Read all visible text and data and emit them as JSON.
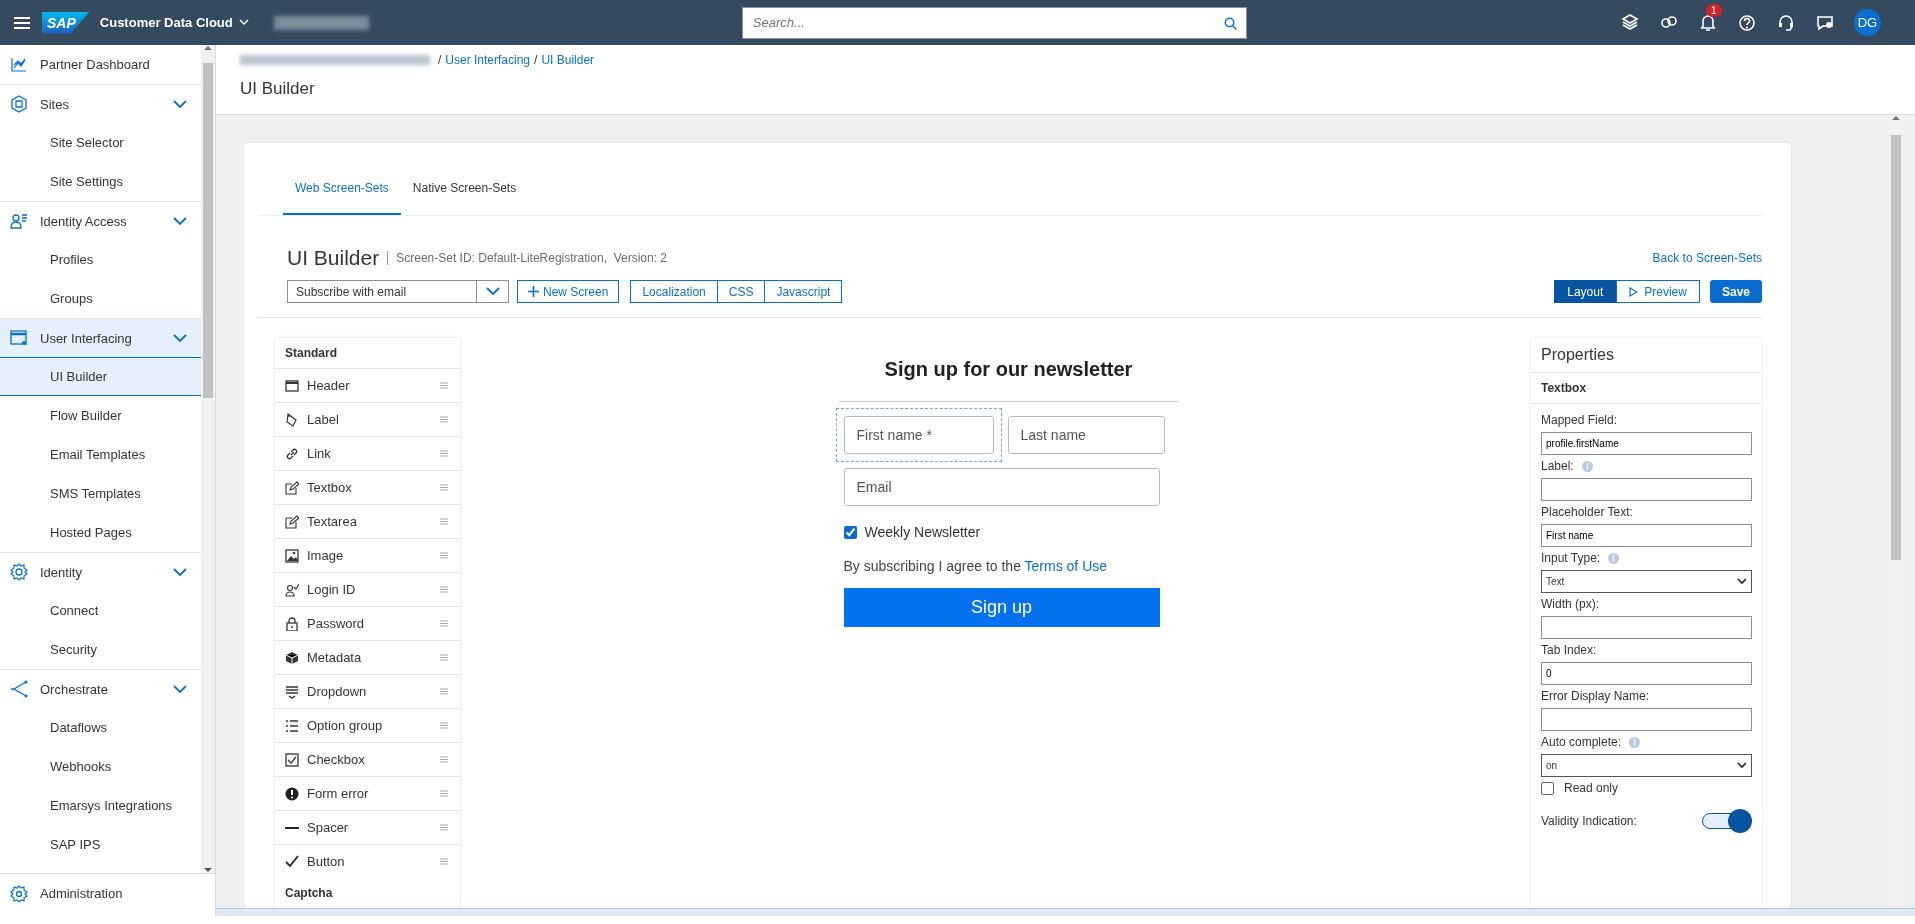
{
  "topbar": {
    "logo": "SAP",
    "product": "Customer Data Cloud",
    "search": {
      "placeholder": "Search..."
    },
    "notification_count": "1",
    "avatar": "DG"
  },
  "sidebar": {
    "items": [
      {
        "label": "Partner Dashboard",
        "selected": false
      },
      {
        "label": "Sites",
        "selected": false,
        "expanded": true,
        "children": [
          {
            "label": "Site Selector",
            "selected": false
          },
          {
            "label": "Site Settings",
            "selected": false
          }
        ]
      },
      {
        "label": "Identity Access",
        "selected": false,
        "expanded": true,
        "children": [
          {
            "label": "Profiles",
            "selected": false
          },
          {
            "label": "Groups",
            "selected": false
          }
        ]
      },
      {
        "label": "User Interfacing",
        "selected": true,
        "expanded": true,
        "children": [
          {
            "label": "UI Builder",
            "selected": true
          },
          {
            "label": "Flow Builder",
            "selected": false
          },
          {
            "label": "Email Templates",
            "selected": false
          },
          {
            "label": "SMS Templates",
            "selected": false
          },
          {
            "label": "Hosted Pages",
            "selected": false
          }
        ]
      },
      {
        "label": "Identity",
        "selected": false,
        "expanded": true,
        "children": [
          {
            "label": "Connect",
            "selected": false
          },
          {
            "label": "Security",
            "selected": false
          }
        ]
      },
      {
        "label": "Orchestrate",
        "selected": false,
        "expanded": true,
        "children": [
          {
            "label": "Dataflows",
            "selected": false
          },
          {
            "label": "Webhooks",
            "selected": false
          },
          {
            "label": "Emarsys Integrations",
            "selected": false
          },
          {
            "label": "SAP IPS",
            "selected": false
          }
        ]
      }
    ],
    "footer": {
      "label": "Administration"
    }
  },
  "breadcrumb": {
    "separator": "/",
    "links": [
      "User Interfacing",
      "UI Builder"
    ]
  },
  "page_title": "UI Builder",
  "tabs": [
    {
      "label": "Web Screen-Sets",
      "selected": true
    },
    {
      "label": "Native Screen-Sets",
      "selected": false
    }
  ],
  "builder": {
    "title": "UI Builder",
    "meta": "Screen-Set ID: Default-LiteRegistration,  Version: 2",
    "back_link": "Back to Screen-Sets",
    "screen_select": "Subscribe with email",
    "new_screen": "New Screen",
    "editors": [
      "Localization",
      "CSS",
      "Javascript"
    ],
    "modes": [
      {
        "label": "Layout",
        "selected": true
      },
      {
        "label": "Preview",
        "selected": false
      }
    ],
    "save": "Save"
  },
  "widgets": [
    {
      "kind": "heading",
      "label": "Standard"
    },
    {
      "kind": "item",
      "label": "Header"
    },
    {
      "kind": "item",
      "label": "Label"
    },
    {
      "kind": "item",
      "label": "Link"
    },
    {
      "kind": "item",
      "label": "Textbox"
    },
    {
      "kind": "item",
      "label": "Textarea"
    },
    {
      "kind": "item",
      "label": "Image"
    },
    {
      "kind": "item",
      "label": "Login ID"
    },
    {
      "kind": "item",
      "label": "Password"
    },
    {
      "kind": "item",
      "label": "Metadata"
    },
    {
      "kind": "item",
      "label": "Dropdown"
    },
    {
      "kind": "item",
      "label": "Option group"
    },
    {
      "kind": "item",
      "label": "Checkbox"
    },
    {
      "kind": "item",
      "label": "Form error"
    },
    {
      "kind": "item",
      "label": "Spacer"
    },
    {
      "kind": "item",
      "label": "Button"
    },
    {
      "kind": "heading",
      "label": "Captcha"
    }
  ],
  "form": {
    "heading": "Sign up for our newsletter",
    "name_fields": [
      {
        "placeholder": "First name *",
        "selected": true
      },
      {
        "placeholder": "Last name",
        "selected": false
      }
    ],
    "email": {
      "placeholder": "Email"
    },
    "newsletter": {
      "label": "Weekly Newsletter",
      "checked": true
    },
    "terms": {
      "text": "By subscribing I agree to the",
      "link": "Terms of Use"
    },
    "submit": "Sign up"
  },
  "properties": {
    "title": "Properties",
    "subtitle": "Textbox",
    "fields": [
      {
        "kind": "text",
        "label": "Mapped Field:",
        "info": false,
        "value": "profile.firstName"
      },
      {
        "kind": "text",
        "label": "Label:",
        "info": true
      },
      {
        "kind": "text",
        "label": "Placeholder Text:",
        "info": false,
        "value": "First name"
      },
      {
        "kind": "select",
        "label": "Input Type:",
        "info": true,
        "value": "Text"
      },
      {
        "kind": "text",
        "label": "Width (px):",
        "info": false
      },
      {
        "kind": "text",
        "label": "Tab Index:",
        "info": false,
        "value": "0"
      },
      {
        "kind": "text",
        "label": "Error Display Name:",
        "info": false
      },
      {
        "kind": "select",
        "label": "Auto complete:",
        "info": true,
        "value": "on"
      },
      {
        "kind": "checkbox",
        "label": "Read only",
        "checked": false
      },
      {
        "kind": "toggle",
        "label": "Validity Indication:",
        "on": true
      }
    ]
  }
}
